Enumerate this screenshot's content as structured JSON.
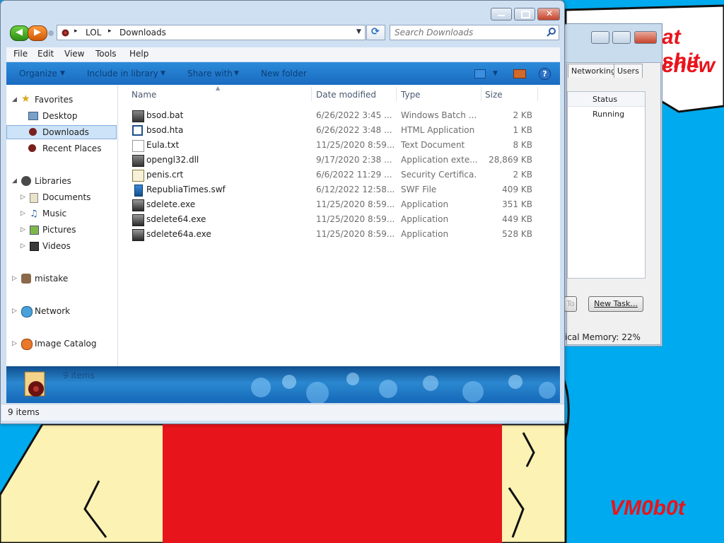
{
  "desktop": {
    "bubble_line1": "at shit",
    "bubble_line2": "chew",
    "signature": "VM0b0t"
  },
  "task_manager": {
    "tabs": [
      "Networking",
      "Users"
    ],
    "column_status": "Status",
    "row_status": "Running",
    "partial_button": "To",
    "new_task_button": "New Task...",
    "memory_status": "ical Memory: 22%"
  },
  "explorer": {
    "breadcrumb": [
      "LOL",
      "Downloads"
    ],
    "search_placeholder": "Search Downloads",
    "menu": [
      "File",
      "Edit",
      "View",
      "Tools",
      "Help"
    ],
    "commands": [
      "Organize",
      "Include in library",
      "Share with",
      "New folder"
    ],
    "nav": {
      "favorites": "Favorites",
      "desktop": "Desktop",
      "downloads": "Downloads",
      "recent": "Recent Places",
      "libraries": "Libraries",
      "documents": "Documents",
      "music": "Music",
      "pictures": "Pictures",
      "videos": "Videos",
      "mistake": "mistake",
      "network": "Network",
      "image_catalog": "Image Catalog"
    },
    "columns": {
      "name": "Name",
      "date": "Date modified",
      "type": "Type",
      "size": "Size"
    },
    "files": [
      {
        "name": "bsod.bat",
        "date": "6/26/2022 3:45 ...",
        "type": "Windows Batch ...",
        "size": "2 KB",
        "icon": "batch-file-icon"
      },
      {
        "name": "bsod.hta",
        "date": "6/26/2022 3:48 ...",
        "type": "HTML Application",
        "size": "1 KB",
        "icon": "hta-file-icon"
      },
      {
        "name": "Eula.txt",
        "date": "11/25/2020 8:59...",
        "type": "Text Document",
        "size": "8 KB",
        "icon": "text-file-icon"
      },
      {
        "name": "opengl32.dll",
        "date": "9/17/2020 2:38 ...",
        "type": "Application exte...",
        "size": "28,869 KB",
        "icon": "dll-file-icon"
      },
      {
        "name": "penis.crt",
        "date": "6/6/2022 11:29 ...",
        "type": "Security Certifica...",
        "size": "2 KB",
        "icon": "certificate-file-icon"
      },
      {
        "name": "RepubliaTimes.swf",
        "date": "6/12/2022 12:58...",
        "type": "SWF File",
        "size": "409 KB",
        "icon": "swf-file-icon"
      },
      {
        "name": "sdelete.exe",
        "date": "11/25/2020 8:59...",
        "type": "Application",
        "size": "351 KB",
        "icon": "exe-file-icon"
      },
      {
        "name": "sdelete64.exe",
        "date": "11/25/2020 8:59...",
        "type": "Application",
        "size": "449 KB",
        "icon": "exe-file-icon"
      },
      {
        "name": "sdelete64a.exe",
        "date": "11/25/2020 8:59...",
        "type": "Application",
        "size": "528 KB",
        "icon": "exe-file-icon"
      }
    ],
    "details_count": "9 items",
    "status_count": "9 items"
  }
}
